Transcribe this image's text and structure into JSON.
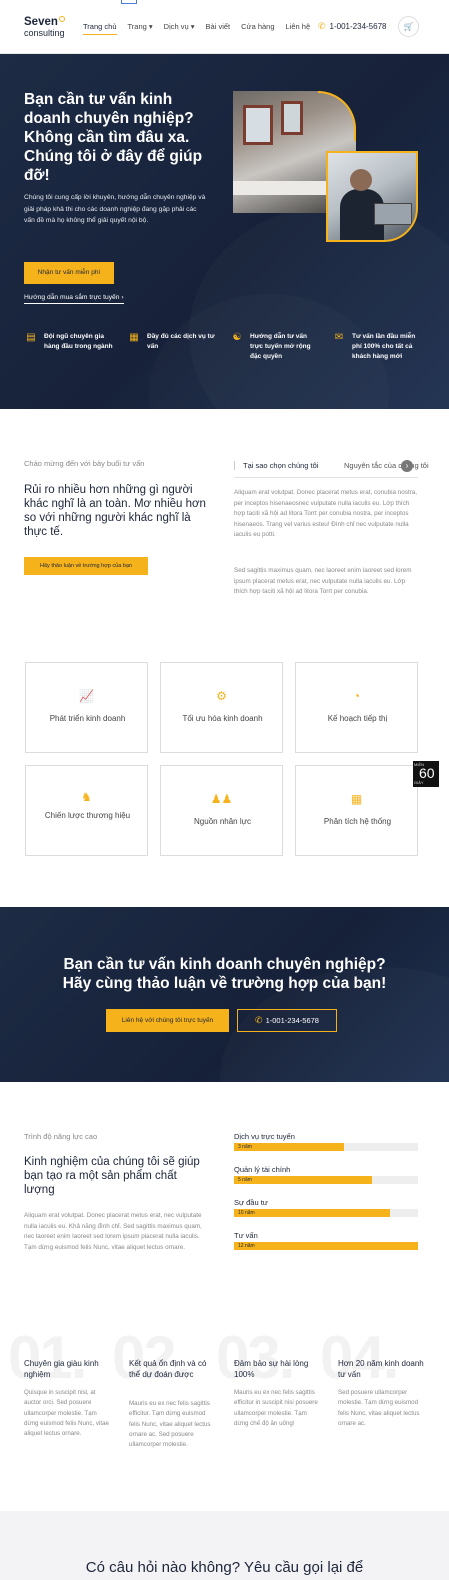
{
  "header": {
    "logo_main": "Seven",
    "logo_sub": "consulting",
    "nav": [
      {
        "label": "Trang chủ",
        "active": true
      },
      {
        "label": "Trang ▾",
        "active": false
      },
      {
        "label": "Dịch vụ ▾",
        "active": false
      },
      {
        "label": "Bài viết",
        "active": false
      },
      {
        "label": "Cửa hàng",
        "active": false
      },
      {
        "label": "Liên hệ",
        "active": false
      }
    ],
    "phone": "1-001-234-5678",
    "phone_icon": "phone-icon",
    "cart_icon": "cart-icon"
  },
  "hero": {
    "title": "Bạn cần tư vấn kinh doanh chuyên nghiệp? Không cần tìm đâu xa. Chúng tôi ở đây để giúp đỡ!",
    "description": "Chúng tôi cung cấp lời khuyên, hướng dẫn chuyên nghiệp và giải pháp khả thi cho các doanh nghiệp đang gặp phải các vấn đề mà họ không thể giải quyết nội bộ.",
    "cta_label": "Nhận tư vấn miễn phí",
    "link_label": "Hướng dẫn mua sắm trực tuyến",
    "features": [
      {
        "icon": "id-card-icon",
        "text": "Đội ngũ chuyên gia hàng đầu trong ngành"
      },
      {
        "icon": "grid-icon",
        "text": "Đầy đủ các dịch vụ tư vấn"
      },
      {
        "icon": "handshake-icon",
        "text": "Hướng dẫn tư vấn trực tuyến mở rộng đặc quyền"
      },
      {
        "icon": "chat-icon",
        "text": "Tư vấn lần đầu miễn phí 100% cho tất cả khách hàng mới"
      }
    ]
  },
  "welcome": {
    "eyebrow": "Chào mừng đến với bảy buổi tư vấn",
    "title": "Rủi ro nhiều hơn những gì người khác nghĩ là an toàn. Mơ nhiều hơn so với những người khác nghĩ là thực tế.",
    "button": "Hãy thảo luận về trường hợp của bạn",
    "tabs": [
      "Tại sao chọn chúng tôi",
      "Nguyên tắc của chúng tôi"
    ],
    "paragraph1": "Aliquam erat volutpat. Donec placerat metus erat, conubia nostra, per inceptos hisenaeosnec vulputate nulla iaculis eu. Lớp thích hợp taciti xã hội ad litora Torrt per conubia nostra, per inceptos hisenaeos. Trang vel varius esteu! Đình chỉ nec vulputate nulla iaculis eu potti.",
    "paragraph2": "Sed sagittis maximus quam, nec laoreet enim laoreet sed lorem ipsum placerat metus erat, nec vulputate nulla iaculis eu. Lớp thích hợp taciti xã hội ad litora Torrt per conubia."
  },
  "services": [
    {
      "icon": "chart-icon",
      "label": "Phát triển kinh doanh"
    },
    {
      "icon": "gears-icon",
      "label": "Tối ưu hóa kinh doanh"
    },
    {
      "icon": "pie-chart-icon",
      "label": "Kế hoạch tiếp thị"
    },
    {
      "icon": "chess-knight-icon",
      "label": "Chiến lược thương hiệu"
    },
    {
      "icon": "users-icon",
      "label": "Nguồn nhân lực"
    },
    {
      "icon": "calculator-icon",
      "label": "Phân tích hệ thống"
    }
  ],
  "side_badge": {
    "top": "MIỄN",
    "number": "60",
    "bottom": "GIÂY"
  },
  "cta": {
    "title": "Bạn cần tư vấn kinh doanh chuyên nghiệp? Hãy cùng thảo luận về trường hợp của bạn!",
    "primary_button": "Liên hệ với chúng tôi trực tuyến",
    "phone_button": "1-001-234-5678"
  },
  "capability": {
    "eyebrow": "Trình độ năng lực cao",
    "title": "Kinh nghiệm của chúng tôi sẽ giúp bạn tạo ra một sản phẩm chất lượng",
    "description": "Aliquam erat volutpat. Donec placerat metus erat, nec vulputate nulla iaculis eu. Khả năng đình chỉ. Sed sagittis maximus quam, nec laoreet enim laoreet sed lorem ipsum placerat nulla iaculis. Tạm dừng euismod felis Nunc, vitae aliquet lectus ornare.",
    "bars": [
      {
        "label": "Dịch vụ trực tuyến",
        "value_text": "3 năm",
        "percent": 60
      },
      {
        "label": "Quản lý tài chính",
        "value_text": "5 năm",
        "percent": 75
      },
      {
        "label": "Sự đầu tư",
        "value_text": "10 năm",
        "percent": 85
      },
      {
        "label": "Tư vấn",
        "value_text": "12 năm",
        "percent": 100
      }
    ]
  },
  "numbered": [
    {
      "number": "01.",
      "title": "Chuyên gia giàu kinh nghiệm",
      "desc": "Quisque in suscipit nisl, at auctor orci. Sed posuere ullamcorper molestie. Tạm dừng euismod felis Nunc, vitae aliquet lectus ornare."
    },
    {
      "number": "02.",
      "title": "Kết quả ổn định và có thể dự đoán được",
      "desc": "Mauris eu ex nec felis sagittis efficitur. Tạm dừng euismod felis Nunc, vitae aliquet lectus ornare ac. Sed posuere ullamcorper molestie."
    },
    {
      "number": "03.",
      "title": "Đảm bảo sự hài lòng 100%",
      "desc": "Mauris eu ex nec felis sagittis efficitur in suscipit nisi posuere ullamcorper molestie. Tạm dừng chế độ ăn uống!"
    },
    {
      "number": "04.",
      "title": "Hơn 20 năm kinh doanh tư vấn",
      "desc": "Sed posuere ullamcorper molestie. Tạm dừng euismod felis Nunc, vitae aliquet lectus ornare ac."
    }
  ],
  "bottom": {
    "title": "Có câu hỏi nào không? Yêu cầu gọi lại để"
  },
  "colors": {
    "accent": "#f6b21b",
    "navy": "#1c2539"
  }
}
